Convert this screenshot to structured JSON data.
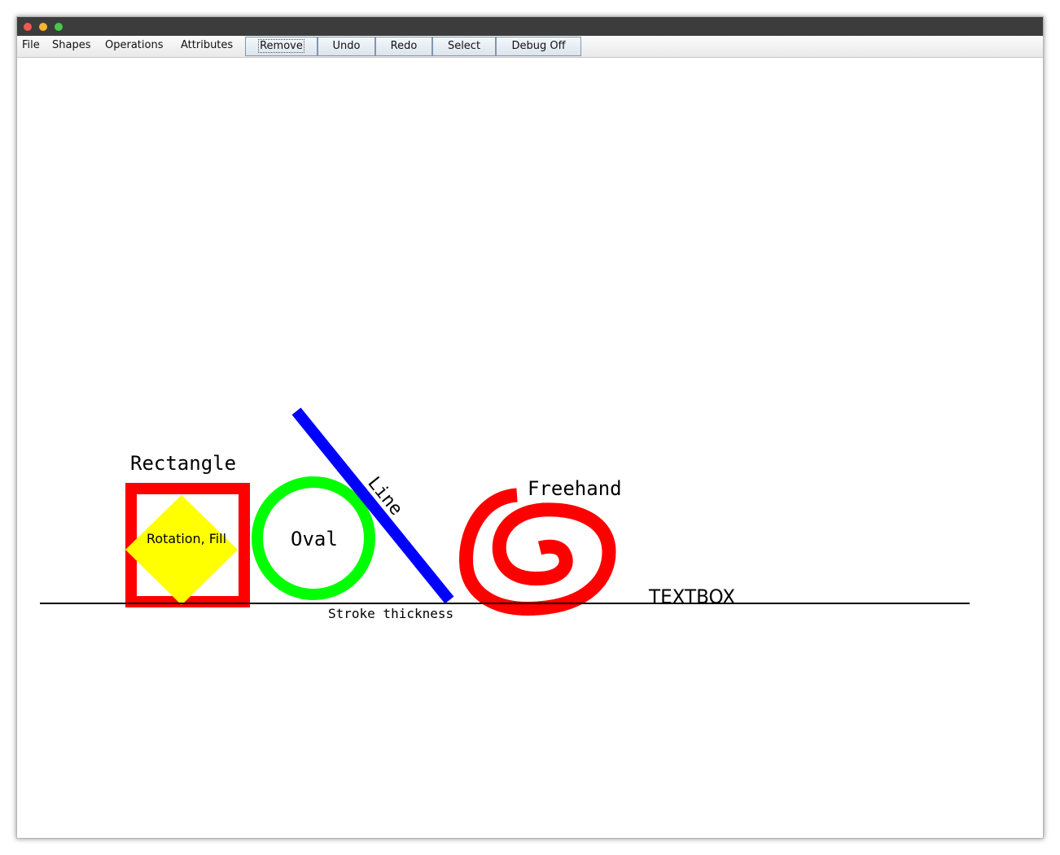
{
  "colors": {
    "titlebar": "#3c3c3c",
    "close": "#ee5a52",
    "minimize": "#f5b52d",
    "zoom": "#46c94a",
    "rectangle_stroke": "#ff0000",
    "diamond_fill": "#ffff00",
    "oval_stroke": "#00ff00",
    "line_stroke": "#0000ff",
    "freehand_stroke": "#ff0000",
    "baseline": "#000000"
  },
  "menubar": {
    "menus": [
      "File",
      "Shapes",
      "Operations",
      "Attributes"
    ],
    "buttons": {
      "remove": "Remove",
      "undo": "Undo",
      "redo": "Redo",
      "select": "Select",
      "debug": "Debug Off"
    }
  },
  "canvas": {
    "labels": {
      "rectangle": "Rectangle",
      "rotation_fill": "Rotation, Fill",
      "oval": "Oval",
      "line": "Line",
      "freehand": "Freehand",
      "textbox": "TEXTBOX",
      "stroke_thickness": "Stroke thickness"
    }
  }
}
